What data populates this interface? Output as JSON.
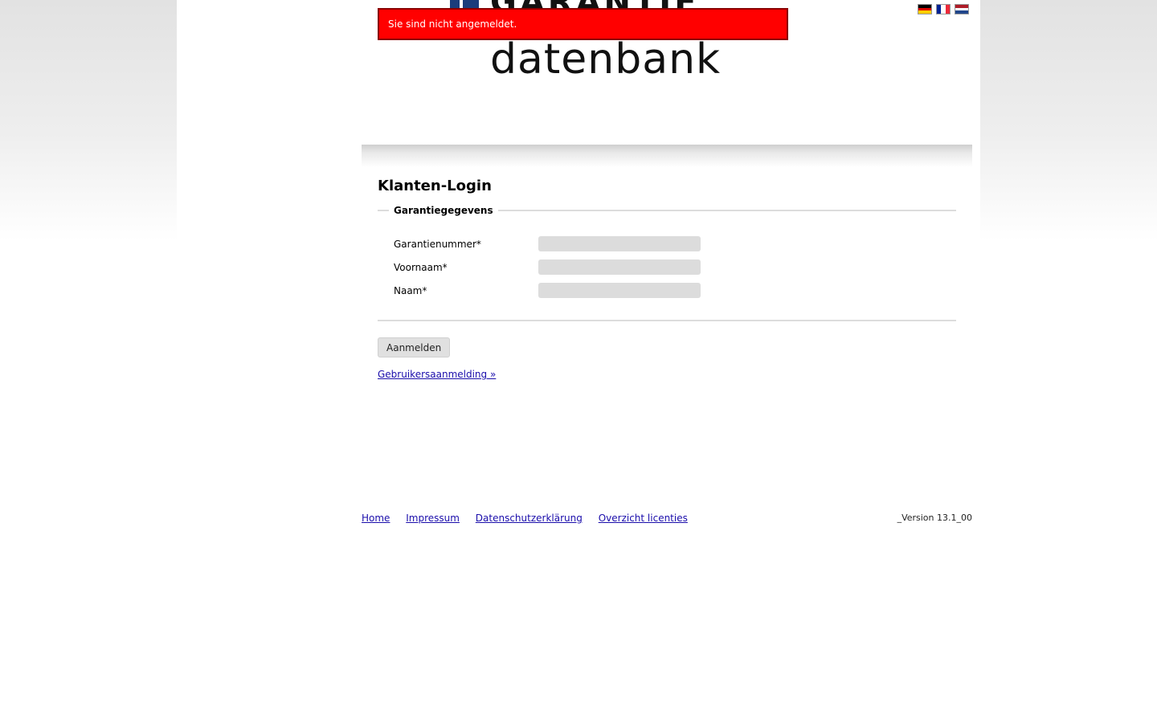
{
  "header": {
    "logo_top_text": "GARANTIE",
    "logo_sub_text": "datenbank",
    "alert_text": "Sie sind nicht angemeldet."
  },
  "languages": [
    {
      "name": "Deutsch",
      "icon": "flag-de-icon",
      "colors": [
        "#000000",
        "#dd0000",
        "#ffce00"
      ]
    },
    {
      "name": "Français",
      "icon": "flag-fr-icon",
      "colors": [
        "#002395",
        "#ffffff",
        "#ed2939"
      ]
    },
    {
      "name": "Nederlands",
      "icon": "flag-nl-icon",
      "colors": [
        "#ae1c28",
        "#ffffff",
        "#21468b"
      ]
    }
  ],
  "login": {
    "title": "Klanten-Login",
    "fieldset_legend": "Garantiegegevens",
    "fields": [
      {
        "label": "Garantienummer*",
        "value": ""
      },
      {
        "label": "Voornaam*",
        "value": ""
      },
      {
        "label": "Naam*",
        "value": ""
      }
    ],
    "submit_label": "Aanmelden",
    "user_login_link": "Gebruikersaanmelding »"
  },
  "footer": {
    "links": [
      "Home",
      "Impressum",
      "Datenschutzerklärung",
      "Overzicht licenties"
    ],
    "version": "_Version 13.1_00"
  },
  "colors": {
    "alert_bg": "#ff0000",
    "alert_border": "#8a0000",
    "input_bg": "#dcdcdc",
    "link": "#1a0dab"
  }
}
